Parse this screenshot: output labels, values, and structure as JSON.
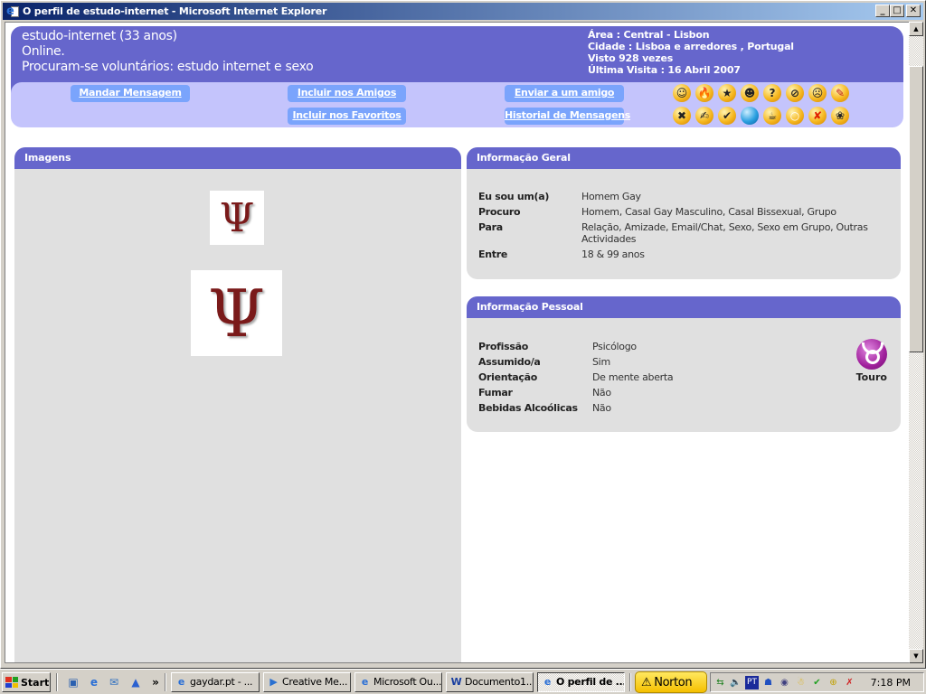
{
  "window": {
    "title": "O perfil de estudo-internet - Microsoft Internet Explorer",
    "controls": {
      "minimize": "_",
      "maximize": "□",
      "close": "✕"
    }
  },
  "profile": {
    "name_age": "estudo-internet (33 anos)",
    "status": "Online.",
    "headline": "Procuram-se voluntários: estudo internet e sexo",
    "area": "Área : Central - Lisbon",
    "cidade": "Cidade : Lisboa e arredores , Portugal",
    "visto": "Visto 928 vezes",
    "ultima_visita": "Última Visita : 16 Abril 2007"
  },
  "actions": {
    "mandar_mensagem": "Mandar Mensagem",
    "incluir_amigos": "Incluir nos Amigos",
    "enviar_amigo": "Enviar a um amigo",
    "incluir_favoritos": "Incluir nos Favoritos",
    "historial": "Historial de Mensagens"
  },
  "emoticons": [
    {
      "name": "wink-smiley",
      "glyph": "☺"
    },
    {
      "name": "flame",
      "glyph": "🔥"
    },
    {
      "name": "star",
      "glyph": "★"
    },
    {
      "name": "grin-smiley",
      "glyph": "☻"
    },
    {
      "name": "question",
      "glyph": "?"
    },
    {
      "name": "no-entry",
      "glyph": "⊘"
    },
    {
      "name": "sad-smiley",
      "glyph": "☹"
    },
    {
      "name": "pencil",
      "glyph": "✎"
    },
    {
      "name": "cross",
      "glyph": "✖"
    },
    {
      "name": "writing-hand",
      "glyph": "✍"
    },
    {
      "name": "checkmark",
      "glyph": "✔"
    },
    {
      "name": "blue-ball",
      "glyph": ""
    },
    {
      "name": "coffee-cup",
      "glyph": "☕"
    },
    {
      "name": "magnifier",
      "glyph": "○"
    },
    {
      "name": "no-paw",
      "glyph": "✘"
    },
    {
      "name": "paw",
      "glyph": "❀"
    }
  ],
  "imagens": {
    "title": "Imagens",
    "images": [
      {
        "alt": "Psi symbol small",
        "glyph": "Ψ"
      },
      {
        "alt": "Psi symbol large",
        "glyph": "Ψ"
      }
    ]
  },
  "informacao_geral": {
    "title": "Informação Geral",
    "rows": [
      {
        "label": "Eu sou um(a)",
        "value": "Homem Gay"
      },
      {
        "label": "Procuro",
        "value": "Homem, Casal Gay Masculino, Casal Bissexual, Grupo"
      },
      {
        "label": "Para",
        "value": "Relação, Amizade, Email/Chat, Sexo, Sexo em Grupo, Outras Actividades"
      },
      {
        "label": "Entre",
        "value": "18 & 99  anos"
      }
    ]
  },
  "informacao_pessoal": {
    "title": "Informação Pessoal",
    "rows": [
      {
        "label": "Profissão",
        "value": "Psicólogo"
      },
      {
        "label": "Assumido/a",
        "value": "Sim"
      },
      {
        "label": "Orientação",
        "value": "De mente aberta"
      },
      {
        "label": "Fumar",
        "value": "Não"
      },
      {
        "label": "Bebidas Alcoólicas",
        "value": "Não"
      }
    ],
    "zodiac": "Touro"
  },
  "taskbar": {
    "start": "Start",
    "more": "»",
    "tasks": [
      {
        "label": "gaydar.pt - ...",
        "icon": "e"
      },
      {
        "label": "Creative Me...",
        "icon": "▶"
      },
      {
        "label": "Microsoft Ou...",
        "icon": "e"
      },
      {
        "label": "Documento1...",
        "icon": "W"
      },
      {
        "label": "O perfil de ...",
        "icon": "e",
        "active": true
      }
    ],
    "norton": "Norton",
    "tray_lang": "PT",
    "clock": "7:18 PM"
  },
  "colors": {
    "header": "#6666cc",
    "action_band": "#c4c4fc",
    "button": "#7aa4fc",
    "panel_body": "#e0e0e0"
  }
}
